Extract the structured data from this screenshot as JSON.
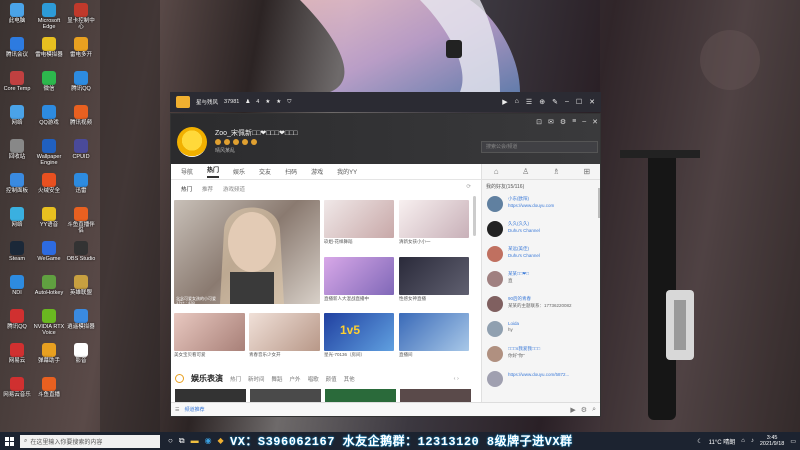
{
  "desktop": {
    "icons": [
      {
        "label": "此电脑",
        "color": "#4aa3e8"
      },
      {
        "label": "Microsoft Edge",
        "color": "#2d9bd8"
      },
      {
        "label": "显卡控制中心",
        "color": "#c0392b"
      },
      {
        "label": "腾讯会议",
        "color": "#2d7be0"
      },
      {
        "label": "雷电模拟器",
        "color": "#e8c020"
      },
      {
        "label": "雷电多开",
        "color": "#e8a020"
      },
      {
        "label": "Core Temp",
        "color": "#c04040"
      },
      {
        "label": "微信",
        "color": "#2db84d"
      },
      {
        "label": "腾讯QQ",
        "color": "#2d8be0"
      },
      {
        "label": "网络",
        "color": "#4aa3e8"
      },
      {
        "label": "QQ游戏",
        "color": "#2d8be0"
      },
      {
        "label": "腾讯视频",
        "color": "#e86020"
      },
      {
        "label": "回收站",
        "color": "#888888"
      },
      {
        "label": "Wallpaper Engine",
        "color": "#2060c0"
      },
      {
        "label": "CPUID",
        "color": "#4a4a9a"
      },
      {
        "label": "控制面板",
        "color": "#3a8ae0"
      },
      {
        "label": "火绒安全",
        "color": "#e85020"
      },
      {
        "label": "迅雷",
        "color": "#2d8be0"
      },
      {
        "label": "网络",
        "color": "#3ab0e0"
      },
      {
        "label": "YY语音",
        "color": "#e8c020"
      },
      {
        "label": "斗鱼直播伴侣",
        "color": "#e86020"
      },
      {
        "label": "Steam",
        "color": "#1b2838"
      },
      {
        "label": "WeGame",
        "color": "#2d6be0"
      },
      {
        "label": "OBS Studio",
        "color": "#333333"
      },
      {
        "label": "NDI",
        "color": "#2d8be0"
      },
      {
        "label": "AutoHotkey",
        "color": "#60a040"
      },
      {
        "label": "英雄联盟",
        "color": "#c8a040"
      },
      {
        "label": "腾讯QQ",
        "color": "#d03030"
      },
      {
        "label": "NVIDIA RTX Voice",
        "color": "#6ab820"
      },
      {
        "label": "逍遥模拟器",
        "color": "#3a8ae0"
      },
      {
        "label": "网易云",
        "color": "#d03030"
      },
      {
        "label": "弹幕助手",
        "color": "#e8a020"
      },
      {
        "label": "影音",
        "color": "#ffffff"
      },
      {
        "label": "网易云音乐",
        "color": "#d03030"
      },
      {
        "label": "斗鱼直播",
        "color": "#e86020"
      }
    ]
  },
  "bgapp": {
    "title": "星与残风",
    "id": "37981",
    "users": "4"
  },
  "window": {
    "channel_name": "Zoo_宋佩新□□❤□□□❤□□□",
    "channel_sub": "晴风某乱",
    "search_placeholder": "搜索公会/频道",
    "tabs": [
      "导航",
      "热门",
      "娱乐",
      "交友",
      "扫码",
      "游戏",
      "我的YY"
    ],
    "subtabs": [
      "热门",
      "推荐",
      "游戏频道"
    ],
    "cards": [
      {
        "caption": "念念可爱女孩的小可爱",
        "meta": "1万+ · 430"
      },
      {
        "caption": "玖姐-花样舞蹈",
        "meta": "1325"
      },
      {
        "caption": "清新女孩小小一",
        "meta": ""
      },
      {
        "caption": "直播新人大混战直播中",
        "meta": "18952"
      },
      {
        "caption": "性感女神直播",
        "meta": ""
      },
      {
        "caption": "美女宝贝看可爱",
        "meta": ""
      },
      {
        "caption": "青春音乐少女开",
        "meta": ""
      },
      {
        "caption": "星光-70136（房间）",
        "meta": "1v5"
      },
      {
        "caption": "直播间",
        "meta": ""
      }
    ],
    "section_title": "娱乐表演",
    "section_links": [
      "热门",
      "新时间",
      "舞蹈",
      "户外",
      "唱歌",
      "颜值",
      "其他"
    ],
    "bottom_link": "频道推荐"
  },
  "rightpanel": {
    "label": "我的好友(15/116)",
    "messages": [
      {
        "name": "小东(欧阳)",
        "text": "https://www.douyu.com",
        "link": true
      },
      {
        "name": "久久(久久)",
        "text": "Duhu's Channel",
        "link": true
      },
      {
        "name": "某远(美佳)",
        "text": "Duhu's Channel",
        "link": true
      },
      {
        "name": "某某□□❤□",
        "text": "直",
        "link": false
      },
      {
        "name": "90后的青春",
        "text": "某某的主题联系：17736220082",
        "link": false
      },
      {
        "name": "Loida",
        "text": "hy",
        "link": false
      },
      {
        "name": "□□□s我爱我□□□",
        "text": "你好\"你\"",
        "link": false
      },
      {
        "name": "",
        "text": "https://www.douyu.com/5872...",
        "link": true
      }
    ]
  },
  "taskbar": {
    "search_placeholder": "在这里输入你要搜索的内容",
    "banner": "VX：S396062167 水友企鹅群：12313120  8级牌子进VX群",
    "weather": "11°C 晴朗",
    "time": "3:45",
    "date": "2021/9/18"
  }
}
